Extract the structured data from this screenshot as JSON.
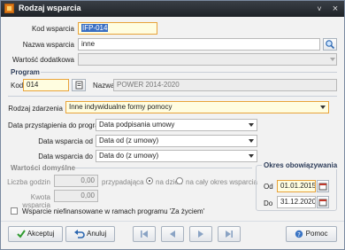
{
  "window": {
    "title": "Rodzaj wsparcia",
    "minimize": "˅",
    "close": "×"
  },
  "form": {
    "kod_wsparcia_label": "Kod wsparcia",
    "kod_wsparcia_value": "IFP-014",
    "nazwa_wsparcia_label": "Nazwa wsparcia",
    "nazwa_wsparcia_value": "inne",
    "wartosc_dodatkowa_label": "Wartość dodatkowa",
    "wartosc_dodatkowa_value": ""
  },
  "program": {
    "title": "Program",
    "kod_label": "Kod",
    "kod_value": "014",
    "nazwa_label": "Nazwa",
    "nazwa_value": "POWER 2014-2020"
  },
  "zdarzenie": {
    "label": "Rodzaj zdarzenia",
    "value": "Inne indywidualne formy pomocy"
  },
  "daty": {
    "przystapienia_label": "Data przystąpienia do programu",
    "przystapienia_value": "Data podpisania umowy",
    "od_label": "Data wsparcia od",
    "od_value": "Data od (z umowy)",
    "do_label": "Data wsparcia do",
    "do_value": "Data do (z umowy)"
  },
  "domyslne": {
    "title": "Wartości domyślne",
    "liczba_godzin_label": "Liczba godzin",
    "liczba_godzin_value": "0,00",
    "przypadajaca": "przypadająca",
    "na_dzien": "na dzień",
    "na_caly_okres": "na cały okres wsparcia",
    "kwota_label": "Kwota wsparcia",
    "kwota_value": "0,00",
    "niefinansowane": "Wsparcie niefinansowane w ramach programu 'Za życiem'"
  },
  "okres": {
    "title": "Okres obowiązywania",
    "od_label": "Od",
    "od_value": "01.01.2015",
    "do_label": "Do",
    "do_value": "31.12.2020"
  },
  "buttons": {
    "akceptuj": "Akceptuj",
    "anuluj": "Anuluj",
    "pomoc": "Pomoc"
  },
  "colors": {
    "accent": "#e8a33a",
    "titlebar": "#2a2e34",
    "group_title": "#2d3d5a"
  }
}
